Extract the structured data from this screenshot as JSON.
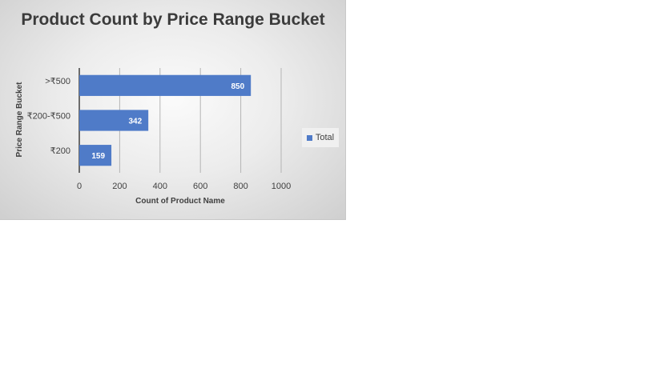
{
  "chart_data": {
    "type": "bar",
    "orientation": "horizontal",
    "title": "Product Count by Price Range Bucket",
    "xlabel": "Count  of Product Name",
    "ylabel": "Price Range Bucket",
    "categories": [
      ">₹500",
      "₹200-₹500",
      "₹200"
    ],
    "series": [
      {
        "name": "Total",
        "values": [
          850,
          342,
          159
        ]
      }
    ],
    "xlim": [
      0,
      1000
    ],
    "xticks": [
      0,
      200,
      400,
      600,
      800,
      1000
    ],
    "grid": true,
    "legend_position": "right",
    "bar_color": "#4f7bc8"
  }
}
